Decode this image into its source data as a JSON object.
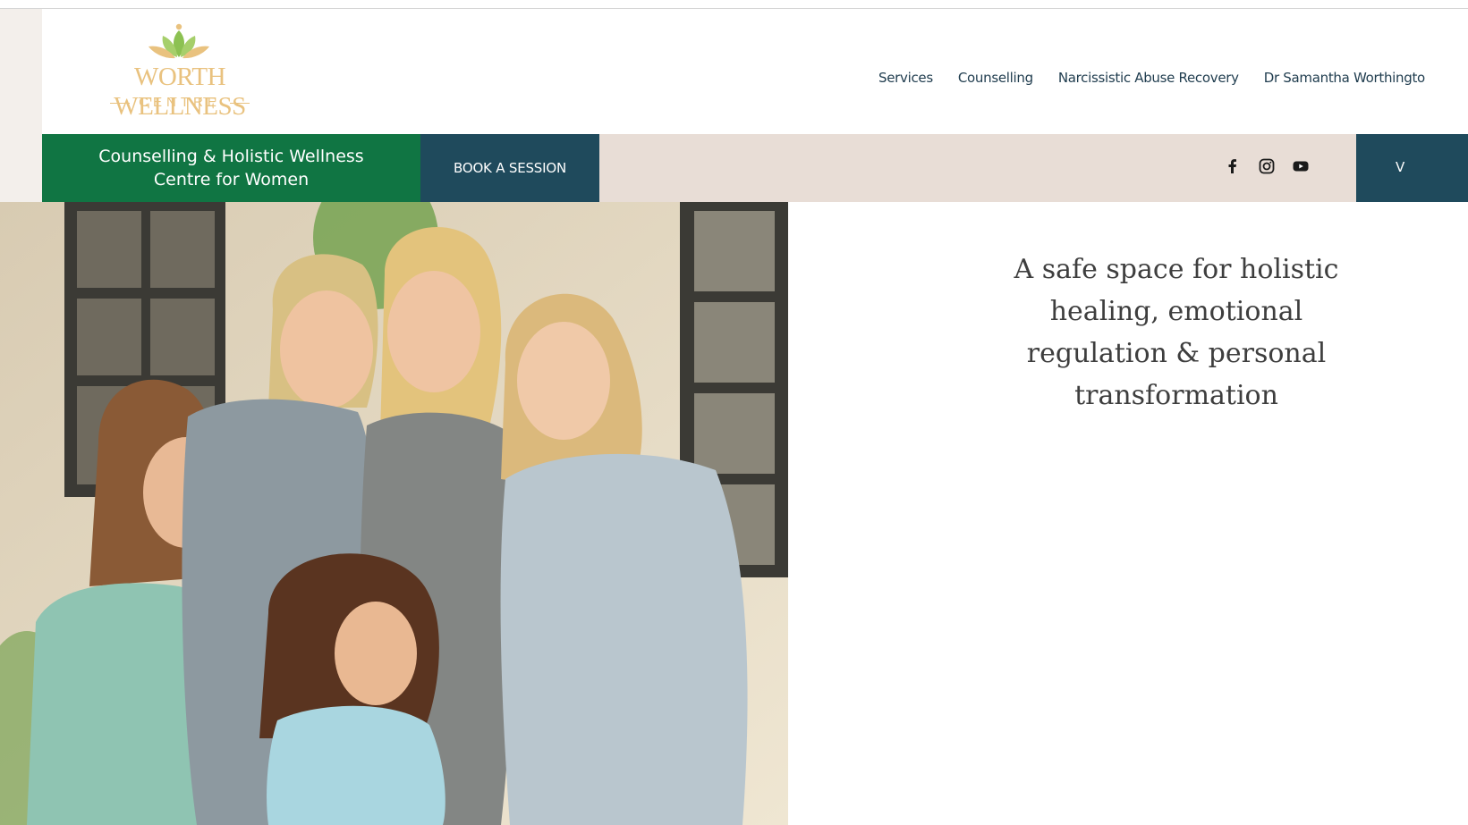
{
  "brand": {
    "name": "WORTH WELLNESS",
    "subtitle": "CENTRE",
    "colors": {
      "gold": "#e9c27f",
      "leaf": "#8cc152"
    }
  },
  "nav": {
    "items": [
      {
        "label": "Services"
      },
      {
        "label": "Counselling"
      },
      {
        "label": "Narcissistic Abuse Recovery"
      },
      {
        "label": "Dr Samantha Worthingto"
      }
    ],
    "color": "#1f3c4e"
  },
  "banner": {
    "tagline_line1": "Counselling & Holistic Wellness",
    "tagline_line2": "Centre for Women",
    "book_button": "BOOK A SESSION",
    "right_button": "V",
    "social": [
      "facebook-icon",
      "instagram-icon",
      "youtube-icon"
    ],
    "colors": {
      "green": "#107543",
      "navy": "#1f4a5c",
      "beige": "#e8ddd6"
    }
  },
  "hero": {
    "heading_lines": [
      "A safe space for holistic",
      "healing, emotional",
      "regulation & personal",
      "transformation"
    ],
    "photo": "group-of-smiling-women-and-girls-photo"
  }
}
